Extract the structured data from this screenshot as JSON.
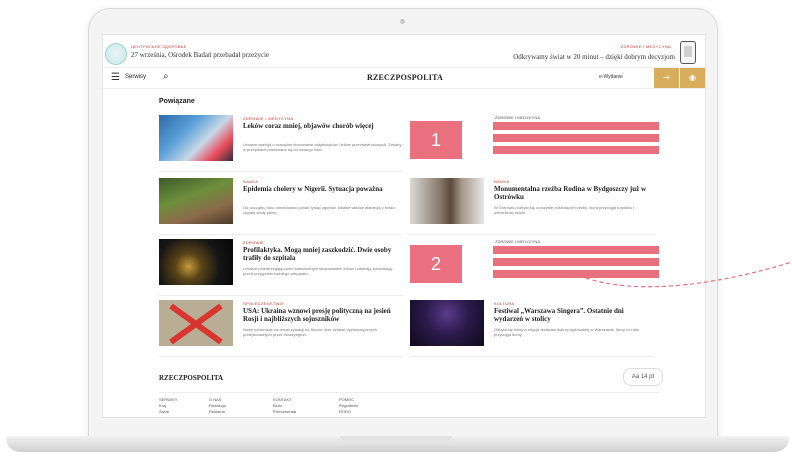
{
  "top": {
    "left_kicker": "ЦЕНТРАЛЬНЕ ЗДОРОВЬЕ",
    "left_text": "27 września, Ośrodek Badań przebadał przeżycie",
    "right_kicker": "ZDROWIE I MEDYCYNA",
    "right_text": "Odkrywamy świat w 20 minut – dzięki dobrym decyzjom"
  },
  "nav": {
    "menu_label": "Serwisy",
    "brand": "RZECZPOSPOLITA",
    "editions": "e-Wydanie"
  },
  "section_title": "Powiązane",
  "articles": [
    {
      "kicker": "ZDROWIE I MEDYCYNA",
      "title": "Leków coraz mniej, objawów chorób więcej",
      "lead": "Lekarze apelują o rozsądne stosowanie antybiotyków i leków przeciwwirusowych. Zmiany w przepisach planowane są od nowego roku."
    },
    {
      "kicker": "NAUKA",
      "title": "Epidemia cholery w Nigerii. Sytuacja poważna",
      "lead": "Od początku roku odnotowano ponad tysiąc zgonów, lokalne władze alarmują o braku czystej wody pitnej."
    },
    {
      "kicker": "NAUKA",
      "title": "Monumentalna rzeźba Rodina w Bydgoszczy już w Ostrówku",
      "lead": "W Ostrówku odbyło się uroczyste odsłonięcie rzeźby, która przyciąga turystów i miłośników sztuki."
    },
    {
      "kicker": "ZDROWIE",
      "title": "Profilaktyka. Mogą mniej zaszkodzić. Dwie osoby trafiły do szpitala",
      "lead": "Lekarze przestrzegają przed samowolnym stosowaniem leków i zalecają konsultację przed przyjęciem każdego preparatu."
    },
    {
      "kicker": "SPOŁECZEŃSTWO",
      "title": "USA: Ukraina wznowi presję polityczną na jesień Rosji i najbliższych sojuszników",
      "lead": "Nowe informacje na temat sytuacji na froncie oraz działań dyplomatycznych podejmowanych przez Waszyngton."
    },
    {
      "kicker": "KULTURA",
      "title": "Festiwal „Warszawa Singera”. Ostatnie dni wydarzeń w stolicy",
      "lead": "Odbyła się kolejna edycja festiwalu kultury żydowskiej w Warszawie, który co roku przyciąga tłumy."
    }
  ],
  "ads": [
    {
      "label": "1",
      "kicker": "ZDROWIE I MEDYCYNA"
    },
    {
      "label": "2",
      "kicker": "ZDROWIE I MEDYCYNA"
    }
  ],
  "footer": {
    "brand": "RZECZPOSPOLITA",
    "font_button": "Aa 14 pt",
    "cols": [
      {
        "head": "SERWISY",
        "items": [
          "Kraj",
          "Świat"
        ]
      },
      {
        "head": "O NAS",
        "items": [
          "Redakcja",
          "Reklama"
        ]
      },
      {
        "head": "KONTAKT",
        "items": [
          "Biuro",
          "Prenumerata"
        ]
      },
      {
        "head": "POMOC",
        "items": [
          "Regulamin",
          "RODO"
        ]
      }
    ]
  },
  "colors": {
    "accent": "#d8ad5c",
    "placeholder": "#e8707f"
  }
}
